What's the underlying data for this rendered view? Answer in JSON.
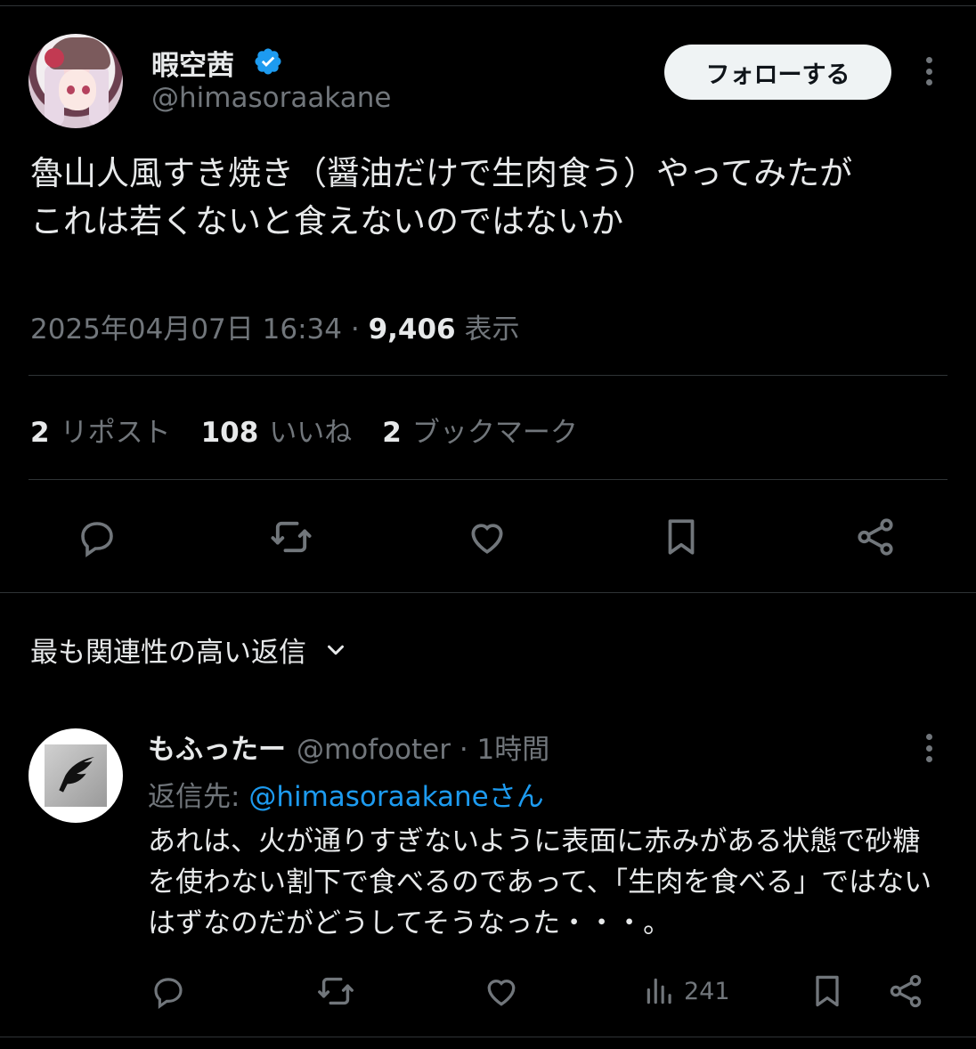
{
  "tweet": {
    "author": {
      "display_name": "暇空茜",
      "handle": "@himasoraakane",
      "verified": true
    },
    "follow_label": "フォローする",
    "text": "魯山人風すき焼き（醤油だけで生肉食う）やってみたが\nこれは若くないと食えないのではないか",
    "timestamp": "2025年04月07日 16:34",
    "separator": "·",
    "views_value": "9,406",
    "views_label": "表示",
    "stats": {
      "reposts_value": "2",
      "reposts_label": "リポスト",
      "likes_value": "108",
      "likes_label": "いいね",
      "bookmarks_value": "2",
      "bookmarks_label": "ブックマーク"
    },
    "actions": [
      "reply-icon",
      "repost-icon",
      "like-icon",
      "bookmark-icon",
      "share-icon"
    ]
  },
  "replies_sort": {
    "label": "最も関連性の高い返信"
  },
  "reply": {
    "display_name": "もふったー",
    "handle": "@mofooter",
    "time": "· 1時間",
    "reply_to_prefix": "返信先: ",
    "reply_to_mention": "@himasoraakaneさん",
    "text": "あれは、火が通りすぎないように表面に赤みがある状態で砂糖を使わない割下で食べるのであって、「生肉を食べる」ではないはずなのだがどうしてそうなった・・・。",
    "views": "241"
  },
  "colors": {
    "background": "#000000",
    "text_primary": "#e7e9ea",
    "text_secondary": "#71767b",
    "accent": "#1d9bf0",
    "divider": "#2f3336"
  }
}
